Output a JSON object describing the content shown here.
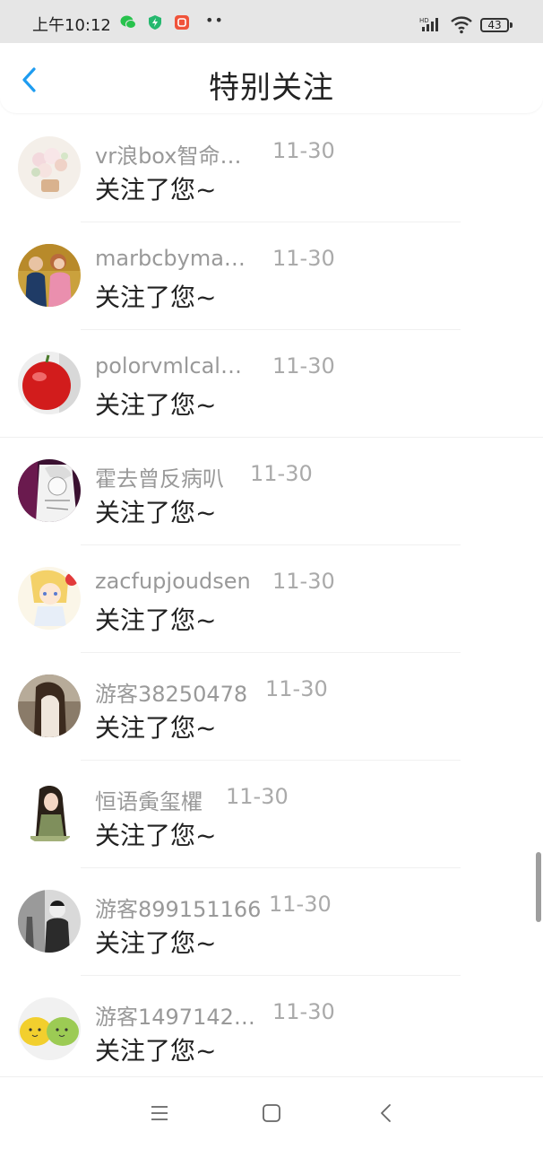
{
  "status_bar": {
    "time": "上午10:12",
    "battery": "43",
    "signal_label": "HD",
    "icons": [
      "wechat-icon",
      "shield-bolt-icon",
      "app-icon",
      "more-dots-icon",
      "signal-icon",
      "wifi-icon",
      "battery-icon"
    ]
  },
  "header": {
    "title": "特别关注",
    "back_icon": "chevron-left-icon",
    "accent": "#1e9cf0"
  },
  "items": [
    {
      "name": "vr浪box智命…",
      "date": "11-30",
      "message": "关注了您~"
    },
    {
      "name": "marbcbyma…",
      "date": "11-30",
      "message": "关注了您~"
    },
    {
      "name": "polorvmlcal…",
      "date": "11-30",
      "message": "关注了您~"
    },
    {
      "name": "霍去曾反病叭",
      "date": "11-30",
      "message": "关注了您~"
    },
    {
      "name": "zacfupjoudsen",
      "date": "11-30",
      "message": "关注了您~"
    },
    {
      "name": "游客38250478",
      "date": "11-30",
      "message": "关注了您~"
    },
    {
      "name": "恒语夤玺欋",
      "date": "11-30",
      "message": "关注了您~"
    },
    {
      "name": "游客899151166",
      "date": "11-30",
      "message": "关注了您~"
    },
    {
      "name": "游客1497142…",
      "date": "11-30",
      "message": "关注了您~"
    }
  ],
  "nav_bar": {
    "icons": [
      "menu-icon",
      "home-square-icon",
      "back-triangle-icon"
    ]
  }
}
